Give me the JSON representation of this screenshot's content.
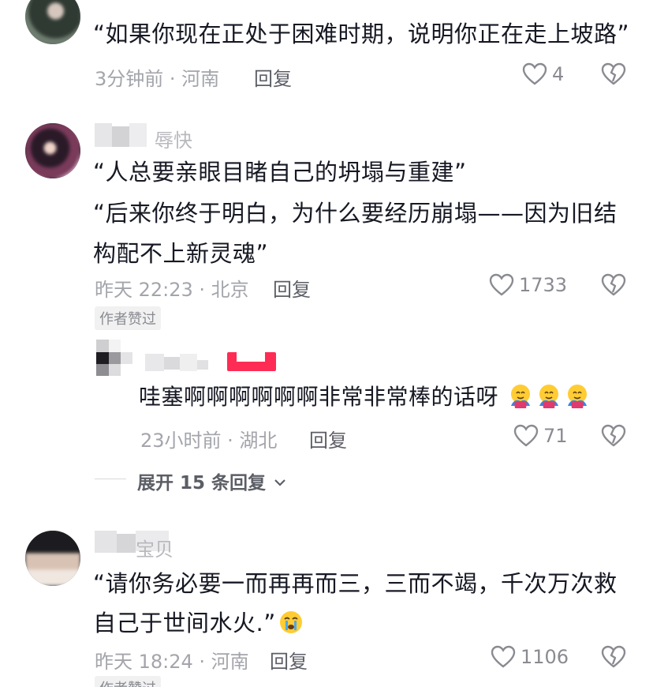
{
  "comments": [
    {
      "text_lines": [
        "“如果你现在正处于困难时期，说明你正在走上坡路”"
      ],
      "meta": "3分钟前 · 河南",
      "reply_label": "回复",
      "likes": "4"
    },
    {
      "username_fragment": "辱快",
      "text_lines": [
        "“人总要亲眼目睹自己的坍塌与重建”",
        "“后来你终于明白，为什么要经历崩塌——因为旧结",
        "构配不上新灵魂”"
      ],
      "meta": "昨天 22:23 · 北京",
      "reply_label": "回复",
      "likes": "1733",
      "badge": "作者赞过"
    },
    {
      "text_lines": [
        "哇塞啊啊啊啊啊啊非常非常棒的话呀"
      ],
      "meta": "23小时前 · 湖北",
      "reply_label": "回复",
      "likes": "71",
      "emoji": "smiling-face-with-hearts"
    },
    {
      "username_fragment": "宝贝",
      "text_lines": [
        "“请你务必要一而再再而三，三而不竭，千次万次救",
        "自己于世间水火.”"
      ],
      "meta": "昨天 18:24 · 河南",
      "reply_label": "回复",
      "likes": "1106",
      "badge": "作者赞过",
      "emoji": "crying-face"
    }
  ],
  "expand_replies": "展开 15 条回复",
  "colors": {
    "text": "#161823",
    "meta": "#a3a5ab",
    "badge_bg": "#f1f1f2",
    "accent_red": "#fe2c55"
  }
}
